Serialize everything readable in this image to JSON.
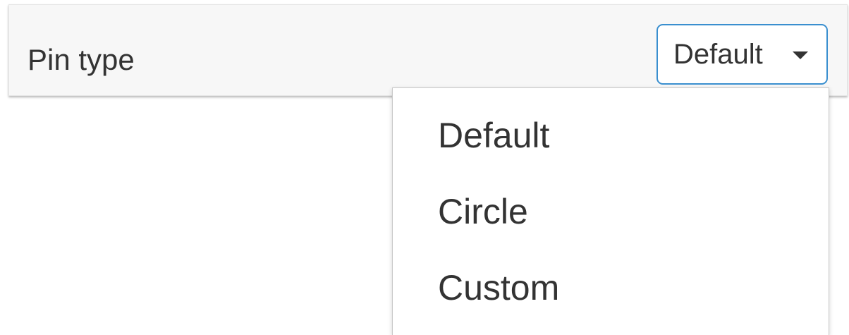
{
  "setting": {
    "label": "Pin type",
    "selected_value": "Default"
  },
  "dropdown": {
    "options": [
      {
        "label": "Default"
      },
      {
        "label": "Circle"
      },
      {
        "label": "Custom"
      }
    ]
  },
  "icons": {
    "caret": "chevron-down-icon"
  },
  "colors": {
    "select_border": "#3a8fcf",
    "row_background": "#f7f7f7",
    "text": "#333333"
  }
}
